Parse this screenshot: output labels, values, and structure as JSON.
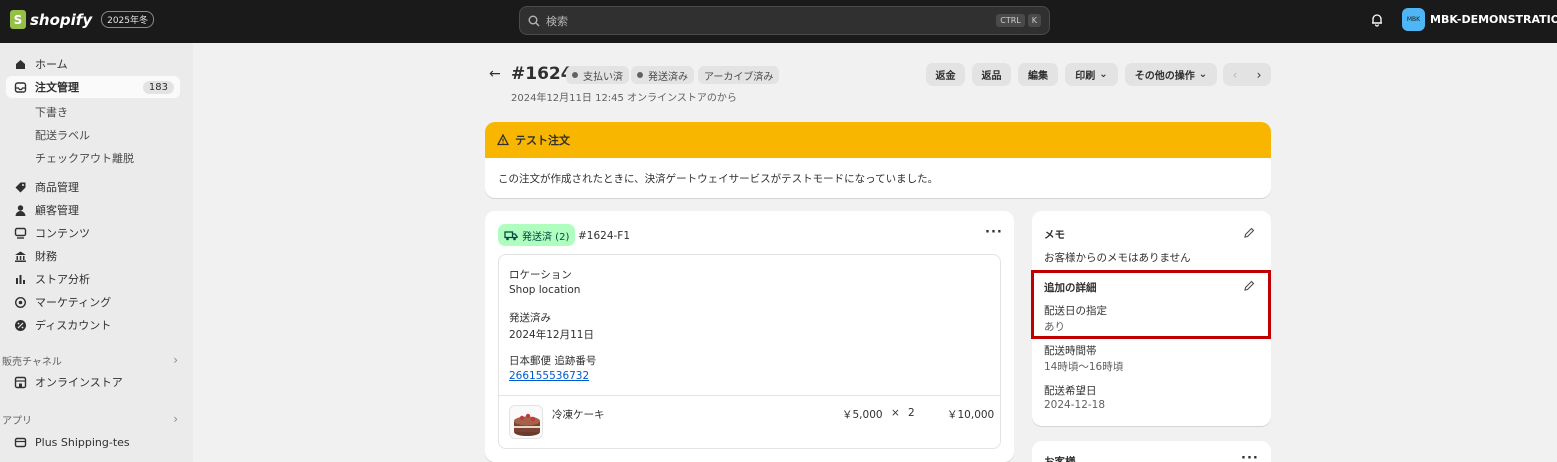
{
  "topbar": {
    "logo_text": "shopify",
    "season_badge": "2025年冬",
    "search_placeholder": "検索",
    "shortcut_ctrl": "CTRL",
    "shortcut_k": "K",
    "avatar_text": "MBK",
    "store_name": "MBK-DEMONSTRATION-..."
  },
  "sidebar": {
    "home": "ホーム",
    "orders": "注文管理",
    "orders_count": "183",
    "drafts": "下書き",
    "shipping_labels": "配送ラベル",
    "abandoned_checkouts": "チェックアウト離脱",
    "products": "商品管理",
    "customers": "顧客管理",
    "content": "コンテンツ",
    "finance": "財務",
    "analytics": "ストア分析",
    "marketing": "マーケティング",
    "discounts": "ディスカウント",
    "sales_channels": "販売チャネル",
    "online_store": "オンラインストア",
    "apps": "アプリ",
    "plus_shipping": "Plus Shipping-tes"
  },
  "order": {
    "title": "#1624",
    "status_paid": "支払い済",
    "status_shipped": "発送済み",
    "status_archived": "アーカイブ済み",
    "subtitle": "2024年12月11日 12:45 オンラインストアのから",
    "actions": {
      "refund": "返金",
      "return": "返品",
      "edit": "編集",
      "print": "印刷",
      "more": "その他の操作"
    }
  },
  "banner": {
    "title": "テスト注文",
    "body": "この注文が作成されたときに、決済ゲートウェイサービスがテストモードになっていました。"
  },
  "fulfillment": {
    "badge": "発送済 (2)",
    "id": "#1624-F1",
    "location_label": "ロケーション",
    "location_value": "Shop location",
    "shipped_label": "発送済み",
    "shipped_date": "2024年12月11日",
    "tracking_label": "日本郵便 追跡番号",
    "tracking_number": "266155536732",
    "item": {
      "name": "冷凍ケーキ",
      "price": "￥5,000",
      "times": "×",
      "qty": "2",
      "total": "￥10,000"
    }
  },
  "notes": {
    "title": "メモ",
    "empty": "お客様からのメモはありません"
  },
  "additional": {
    "title": "追加の詳細",
    "f1_label": "配送日の指定",
    "f1_value": "あり",
    "f2_label": "配送時間帯",
    "f2_value": "14時頃〜16時頃",
    "f3_label": "配送希望日",
    "f3_value": "2024-12-18"
  },
  "customer": {
    "title": "お客様"
  },
  "colors": {
    "topbar": "#1a1a1a",
    "banner": "#f9b600",
    "fulfilled_badge": "#affebf",
    "highlight": "#c00000",
    "link": "#005bd3"
  }
}
